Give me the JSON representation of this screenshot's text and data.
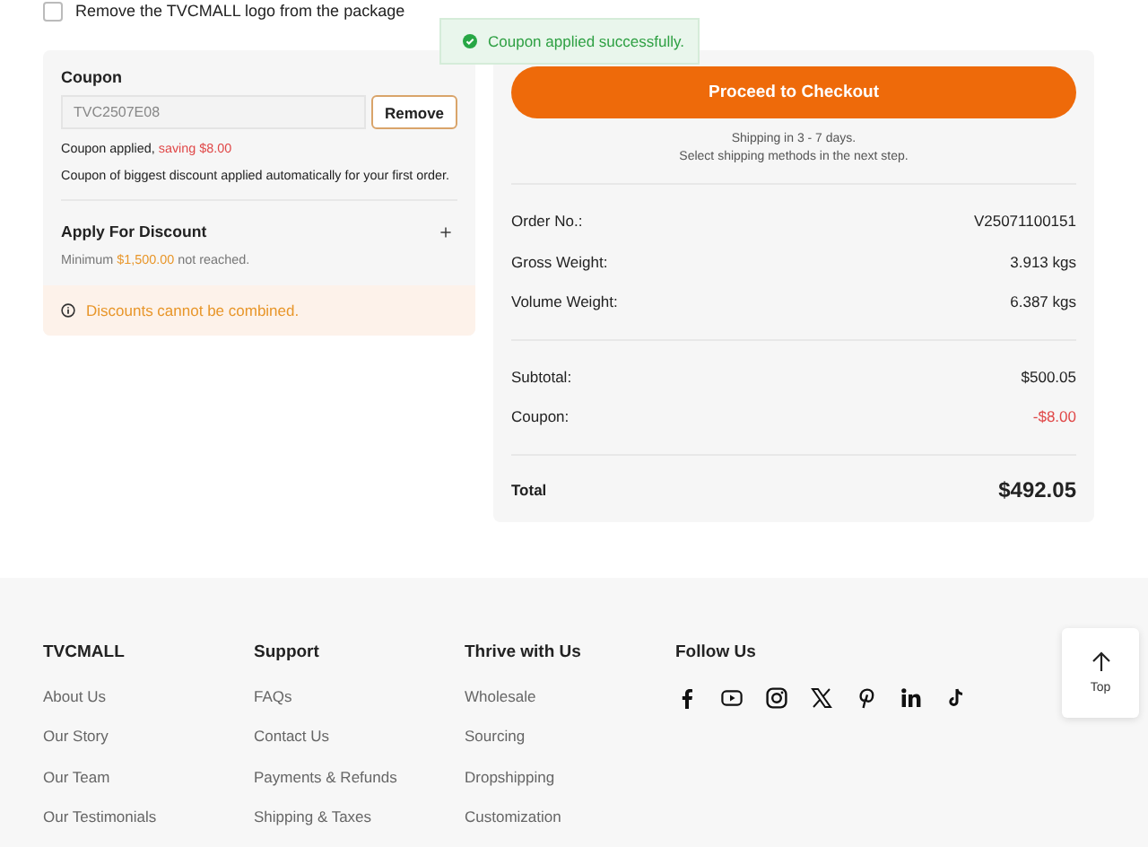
{
  "package_option": {
    "label": "Remove the TVCMALL logo from the package",
    "checked": false
  },
  "toast": {
    "message": "Coupon applied successfully."
  },
  "coupon": {
    "title": "Coupon",
    "value": "TVC2507E08",
    "remove_button": "Remove",
    "applied_note": "Coupon applied,",
    "saving": "saving $8.00",
    "info": "Coupon of biggest discount applied automatically for your first order."
  },
  "discount": {
    "title": "Apply For Discount",
    "expanded": false,
    "minimum_prefix": "Minimum",
    "minimum_amount": "$1,500.00",
    "minimum_suffix": "not reached."
  },
  "warning": "Discounts cannot be combined.",
  "summary": {
    "checkout_button": "Proceed to Checkout",
    "shipping_lines": [
      "Shipping in 3 - 7 days.",
      "Select shipping methods in the next step."
    ],
    "details": [
      {
        "label": "Order No.:",
        "value": "V25071100151"
      },
      {
        "label": "Gross Weight:",
        "value": "3.913 kgs"
      },
      {
        "label": "Volume Weight:",
        "value": "6.387 kgs"
      }
    ],
    "costs": [
      {
        "label": "Subtotal:",
        "value": "$500.05",
        "kind": "plain"
      },
      {
        "label": "Coupon:",
        "value": "-$8.00",
        "kind": "discount"
      }
    ],
    "total_label": "Total",
    "total_value": "$492.05"
  },
  "footer": {
    "columns": [
      {
        "title": "TVCMALL",
        "links": [
          "About Us",
          "Our Story",
          "Our Team",
          "Our Testimonials"
        ]
      },
      {
        "title": "Support",
        "links": [
          "FAQs",
          "Contact Us",
          "Payments & Refunds",
          "Shipping & Taxes"
        ]
      },
      {
        "title": "Thrive with Us",
        "links": [
          "Wholesale",
          "Sourcing",
          "Dropshipping",
          "Customization"
        ]
      }
    ],
    "follow_title": "Follow Us"
  },
  "top_button": {
    "label": "Top"
  }
}
